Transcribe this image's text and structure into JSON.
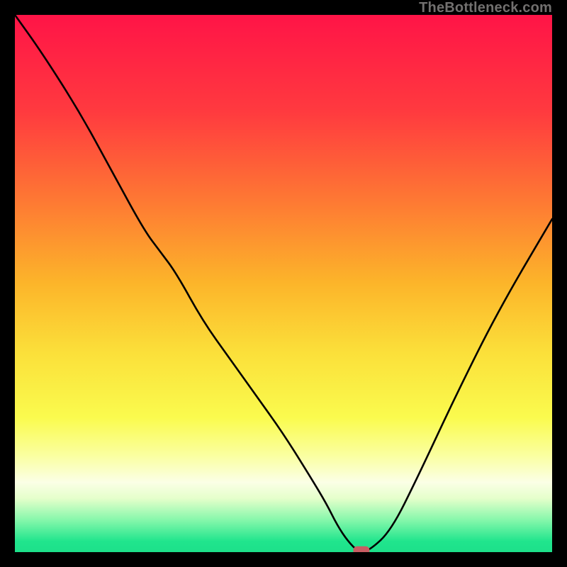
{
  "watermark": "TheBottleneck.com",
  "chart_data": {
    "type": "line",
    "title": "",
    "xlabel": "",
    "ylabel": "",
    "xlim": [
      0,
      100
    ],
    "ylim": [
      0,
      100
    ],
    "x": [
      0,
      5,
      12,
      18,
      24,
      27,
      30,
      35,
      40,
      45,
      50,
      55,
      58,
      60,
      62,
      64,
      66,
      70,
      75,
      82,
      90,
      100
    ],
    "values": [
      100,
      93,
      82,
      71,
      60,
      56,
      52,
      43,
      36,
      29,
      22,
      14,
      9,
      5,
      2,
      0,
      0.3,
      4,
      14,
      29,
      45,
      62
    ],
    "marker": {
      "x": 64.5,
      "y": 0.3
    },
    "gradient_stops": [
      {
        "offset": 0.0,
        "color": "#ff1447"
      },
      {
        "offset": 0.18,
        "color": "#ff3a3f"
      },
      {
        "offset": 0.35,
        "color": "#fe7a33"
      },
      {
        "offset": 0.5,
        "color": "#fcb52a"
      },
      {
        "offset": 0.63,
        "color": "#fbe03a"
      },
      {
        "offset": 0.75,
        "color": "#fafb4e"
      },
      {
        "offset": 0.82,
        "color": "#faffa0"
      },
      {
        "offset": 0.87,
        "color": "#fbffe6"
      },
      {
        "offset": 0.9,
        "color": "#e5ffcb"
      },
      {
        "offset": 0.94,
        "color": "#86f7ab"
      },
      {
        "offset": 0.98,
        "color": "#20e58d"
      },
      {
        "offset": 1.0,
        "color": "#1de08a"
      }
    ],
    "curve_stroke": "#000000",
    "marker_fill": "#c95d63",
    "marker_stroke": "#c95d63"
  }
}
